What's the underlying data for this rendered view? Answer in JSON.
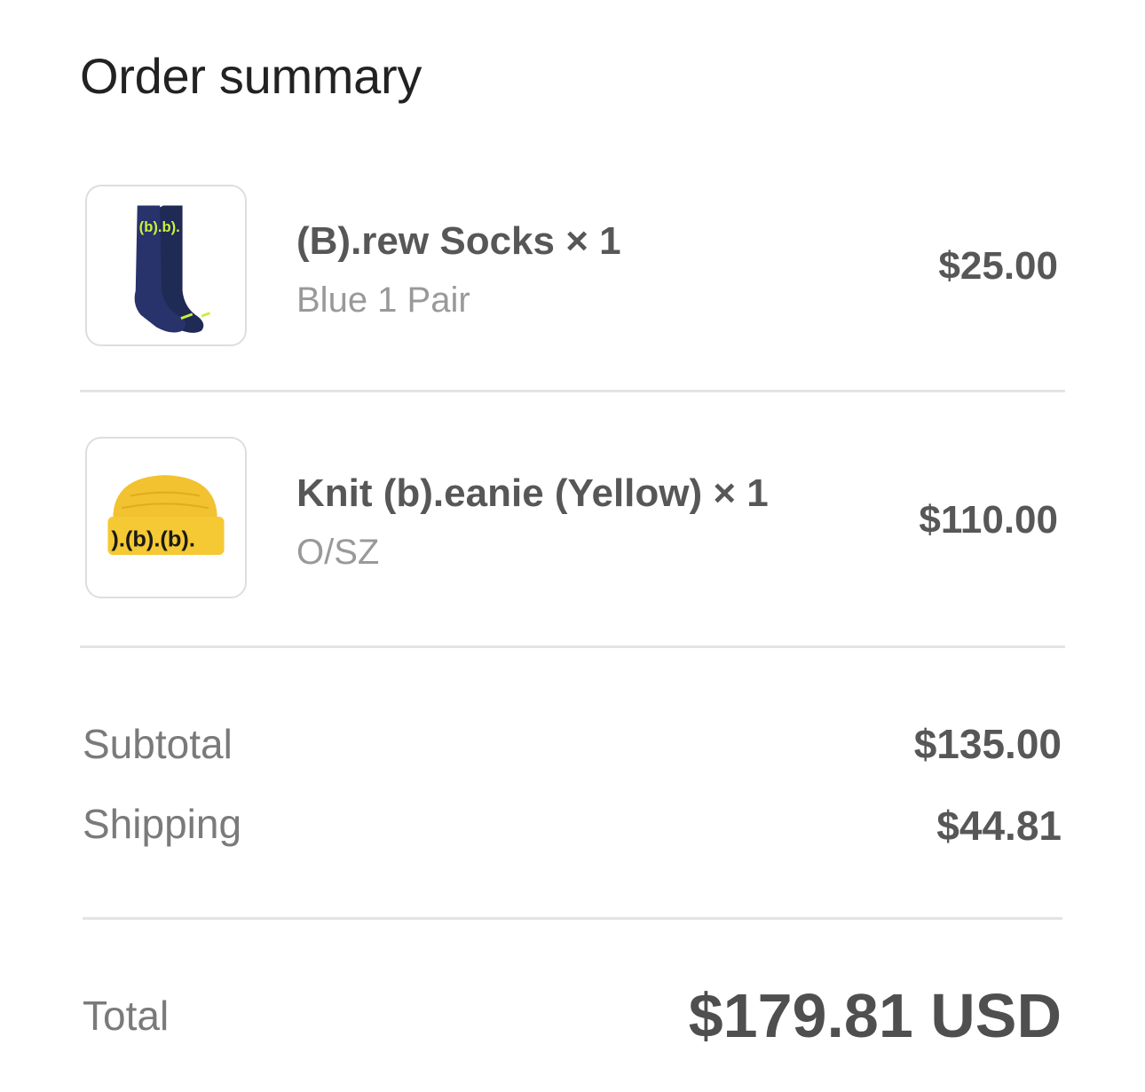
{
  "summary": {
    "title": "Order summary"
  },
  "items": [
    {
      "name": "(B).rew Socks × 1",
      "variant": "Blue 1 Pair",
      "price": "$25.00",
      "image_icon": "socks-thumbnail",
      "logo_text": "(b).b)."
    },
    {
      "name": "Knit (b).eanie (Yellow) × 1",
      "variant": "O/SZ",
      "price": "$110.00",
      "image_icon": "beanie-thumbnail",
      "logo_text": ").(b).(b)."
    }
  ],
  "totals": {
    "subtotal_label": "Subtotal",
    "subtotal_value": "$135.00",
    "shipping_label": "Shipping",
    "shipping_value": "$44.81",
    "total_label": "Total",
    "total_value": "$179.81 USD"
  },
  "colors": {
    "sock_navy": "#1f2a55",
    "neon_green": "#c8f03c",
    "beanie_yellow": "#f2c230",
    "divider": "#e4e4e4"
  }
}
